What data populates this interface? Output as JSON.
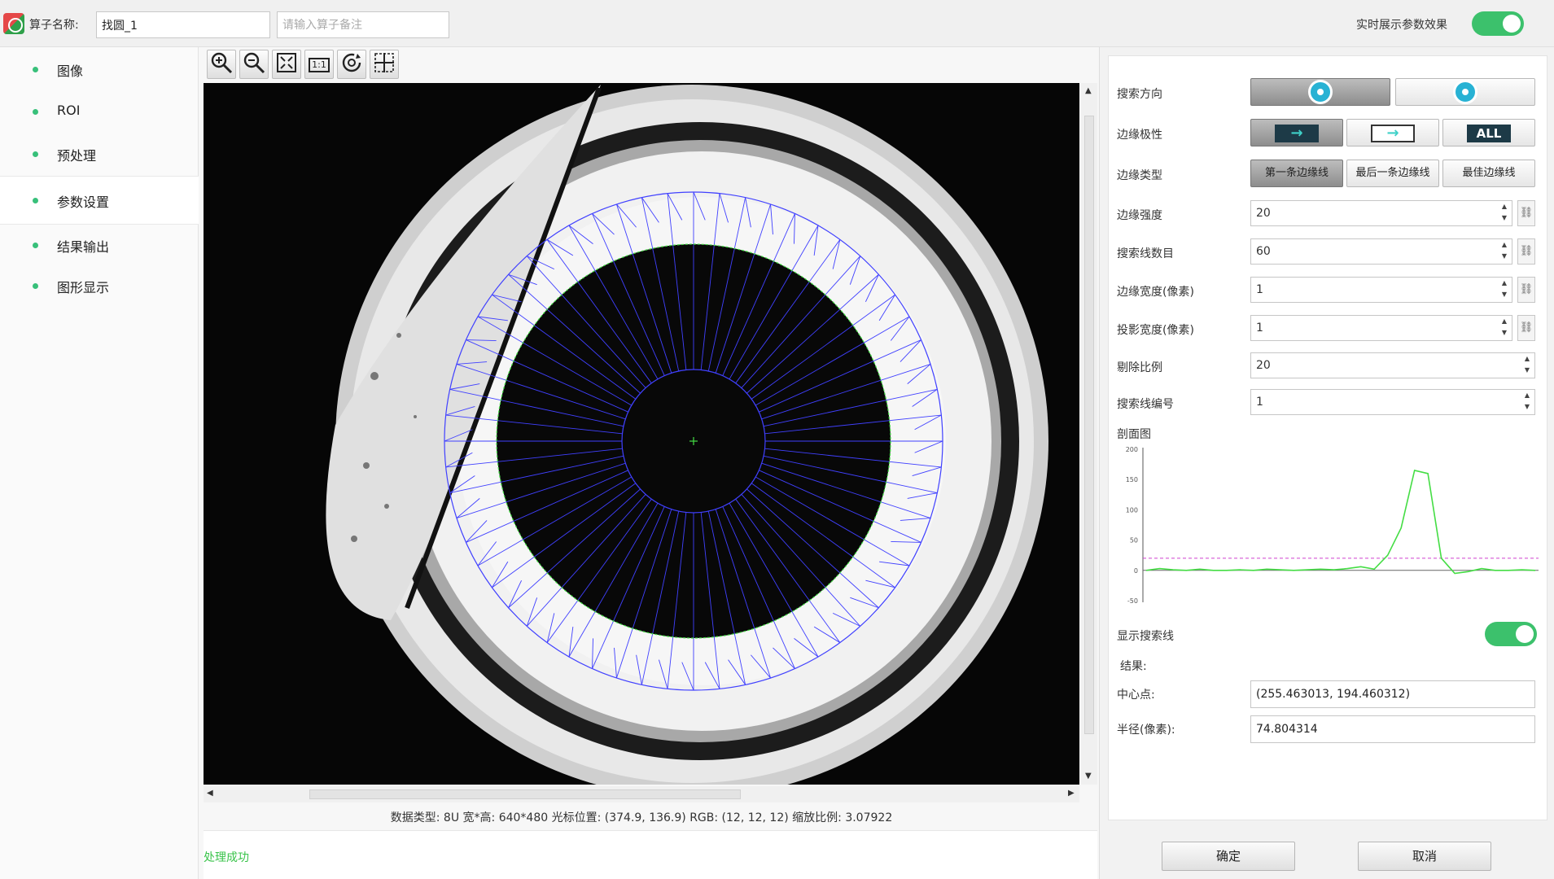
{
  "topbar": {
    "name_label": "算子名称:",
    "name_value": "找圆_1",
    "remark_placeholder": "请输入算子备注",
    "live_label": "实时展示参数效果"
  },
  "sidebar": {
    "items": [
      {
        "label": "图像"
      },
      {
        "label": "ROI"
      },
      {
        "label": "预处理"
      },
      {
        "label": "参数设置"
      },
      {
        "label": "结果输出"
      },
      {
        "label": "图形显示"
      }
    ],
    "active_index": 3
  },
  "viewer": {
    "tools": [
      "zoom-in-icon",
      "zoom-out-icon",
      "fit-icon",
      "actual-size-icon",
      "rotate-icon",
      "crosshair-icon"
    ],
    "actual_size_label": "1:1",
    "status": "数据类型: 8U 宽*高: 640*480 光标位置: (374.9, 136.9) RGB: (12, 12, 12) 缩放比例: 3.07922",
    "message": "处理成功",
    "search_line_count": 60
  },
  "params": {
    "search_direction_label": "搜索方向",
    "edge_polarity_label": "边缘极性",
    "polarity_all": "ALL",
    "edge_type_label": "边缘类型",
    "edge_types": [
      "第一条边缘线",
      "最后一条边缘线",
      "最佳边缘线"
    ],
    "edge_strength_label": "边缘强度",
    "edge_strength": "20",
    "search_lines_label": "搜索线数目",
    "search_lines": "60",
    "edge_width_label": "边缘宽度(像素)",
    "edge_width": "1",
    "proj_width_label": "投影宽度(像素)",
    "proj_width": "1",
    "reject_label": "剔除比例",
    "reject": "20",
    "line_index_label": "搜索线编号",
    "line_index": "1",
    "profile_label": "剖面图",
    "show_lines_label": "显示搜索线",
    "result_label": "结果:",
    "center_label": "中心点:",
    "center_value": "(255.463013, 194.460312)",
    "radius_label": "半径(像素):",
    "radius_value": "74.804314"
  },
  "footer": {
    "ok": "确定",
    "cancel": "取消"
  },
  "colors": {
    "accent_green": "#3cc16c",
    "search_line": "#4040ff",
    "profile_curve": "#44dd44",
    "threshold": "#d040d0"
  },
  "chart_data": {
    "type": "line",
    "ylim": [
      -50,
      200
    ],
    "yticks": [
      "200",
      "150",
      "100",
      "50",
      "0",
      "-50"
    ],
    "threshold": 20,
    "series": [
      {
        "values": [
          0,
          3,
          1,
          0,
          2,
          0,
          0,
          1,
          0,
          2,
          1,
          0,
          1,
          2,
          1,
          3,
          6,
          2,
          25,
          70,
          165,
          160,
          20,
          -5,
          -2,
          3,
          0,
          0,
          1,
          0
        ]
      }
    ]
  }
}
